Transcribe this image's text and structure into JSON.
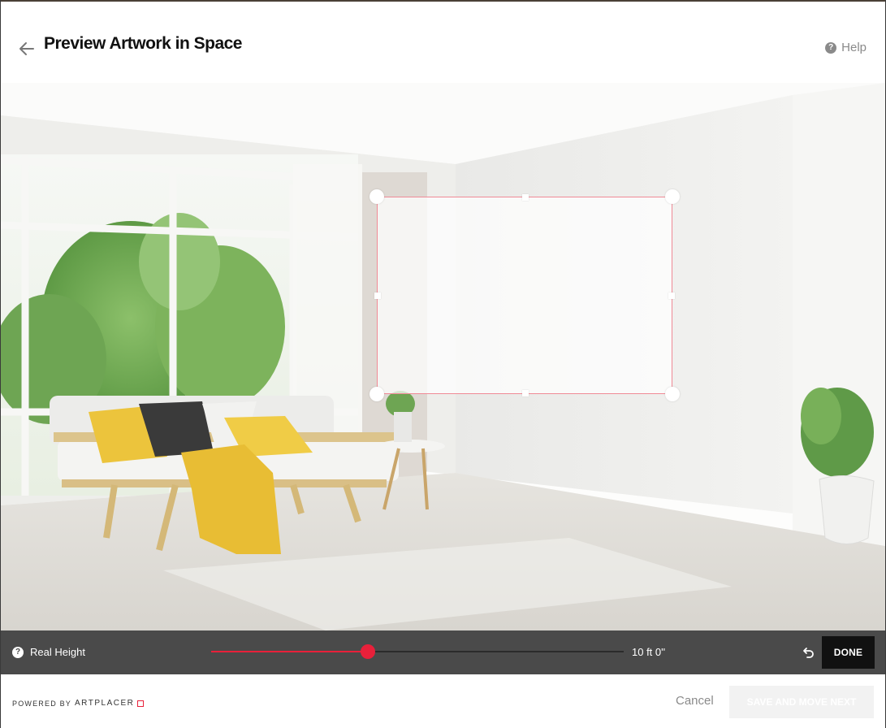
{
  "header": {
    "title": "Preview Artwork in Space",
    "help_label": "Help"
  },
  "controls": {
    "real_height_label": "Real Height",
    "height_value": "10 ft 0''",
    "slider_fraction": 0.38,
    "done_label": "DONE"
  },
  "footer": {
    "powered_by": "POWERED BY",
    "brand": "ARTPLACER",
    "cancel_label": "Cancel",
    "save_label": "SAVE AND MOVE NEXT"
  },
  "colors": {
    "accent": "#e8203a",
    "control_bar": "#4a4a4a",
    "title": "#111111",
    "muted": "#8a8a8a"
  },
  "icons": {
    "back": "arrow-left-icon",
    "help": "question-circle-icon",
    "undo": "undo-icon",
    "brand": "square-outline-icon"
  }
}
